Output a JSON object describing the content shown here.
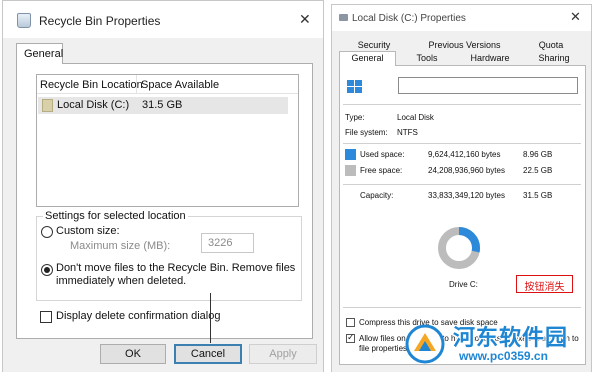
{
  "colors": {
    "used_space": "#2d89d9",
    "free_space": "#bcbcbc",
    "focus_border": "#3c7fb1",
    "annotation_red": "#dd1111",
    "watermark_blue": "#1f86d3"
  },
  "left_dialog": {
    "title": "Recycle Bin Properties",
    "close_glyph": "✕",
    "tab_general": "General",
    "list": {
      "col_location": "Recycle Bin Location",
      "col_space": "Space Available",
      "rows": [
        {
          "location": "Local Disk (C:)",
          "space": "31.5 GB"
        }
      ]
    },
    "settings_group": "Settings for selected location",
    "custom_size_label": "Custom size:",
    "custom_size_selected": false,
    "max_size_label": "Maximum size (MB):",
    "max_size_value": "3226",
    "dont_move_label_line1": "Don't move files to the Recycle Bin. Remove files",
    "dont_move_label_line2": "immediately when deleted.",
    "dont_move_selected": true,
    "confirm_dialog_label": "Display delete confirmation dialog",
    "confirm_dialog_checked": false,
    "ok_label": "OK",
    "cancel_label": "Cancel",
    "apply_label": "Apply"
  },
  "right_dialog": {
    "title": "Local Disk (C:) Properties",
    "close_glyph": "✕",
    "tabs_row1": [
      "Security",
      "Previous Versions",
      "Quota"
    ],
    "tabs_row2": [
      "General",
      "Tools",
      "Hardware",
      "Sharing"
    ],
    "active_tab": "General",
    "type_label": "Type:",
    "type_value": "Local Disk",
    "fs_label": "File system:",
    "fs_value": "NTFS",
    "used_label": "Used space:",
    "used_bytes": "9,624,412,160 bytes",
    "used_size": "8.96 GB",
    "free_label": "Free space:",
    "free_bytes": "24,208,936,960 bytes",
    "free_size": "22.5 GB",
    "capacity_label": "Capacity:",
    "capacity_bytes": "33,833,349,120 bytes",
    "capacity_size": "31.5 GB",
    "used_fraction": 0.284,
    "drive_label": "Drive C:",
    "annotation": "按钮消失",
    "compress_label": "Compress this drive to save disk space",
    "compress_checked": false,
    "index_label_line1": "Allow files on this drive to have contents indexed in addition to",
    "index_label_line2": "file properties",
    "index_checked": true
  },
  "watermark": {
    "name": "河东软件园",
    "url": "www.pc0359.cn"
  }
}
